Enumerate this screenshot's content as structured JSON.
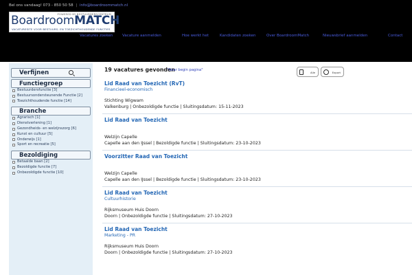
{
  "header": {
    "contact_phone": "Bel ons vandaag! 073 - 850 50 58",
    "separator": "|",
    "contact_email": "info@boardroommatch.nl",
    "logo_tagline": "POWERED BY BESTUURDERSCENTRUM",
    "logo_word_a": "Boardroom",
    "logo_word_b": "MATCH",
    "logo_subtitle": "VACATURESITE VOOR BESTUURS- EN TOEZICHTHOUDENDE FUNCTIES"
  },
  "nav": {
    "items": [
      "Vacatures zoeken",
      "Vacature aanmelden",
      "Hoe werkt het",
      "Kandidaten zoeken",
      "Over BoardroomMatch",
      "Nieuwsbrief aanmelden",
      "Contact"
    ]
  },
  "sidebar": {
    "refine_label": "Verfijnen",
    "groups": [
      {
        "title": "Functiegroep",
        "options": [
          "Bestuurdersfunctie [3]",
          "Bestuursondersteunende Functie [2]",
          "Toezichthoudende functie [14]"
        ]
      },
      {
        "title": "Branche",
        "options": [
          "Agrarisch [1]",
          "Dienstverlening [1]",
          "Gezondheids- en welzijnszorg [6]",
          "Kunst en cultuur [5]",
          "Onderwijs [1]",
          "Sport en recreatie [5]"
        ]
      },
      {
        "title": "Bezoldiging",
        "options": [
          "Betaalde baan [2]",
          "Bezoldigde functie [7]",
          "Onbezoldigde functie [10]"
        ]
      }
    ]
  },
  "results": {
    "count_text": "19 vacatures gevonden",
    "back_link": "\"Naar begin pagina\"",
    "tool_all": "Alle",
    "tool_export": "Export"
  },
  "vacancies": [
    {
      "title": "Lid Raad van Toezicht (RvT)",
      "category": "Financieel-economisch",
      "organisation": "Stichting Wigwam",
      "meta": "Valkenburg | Onbezoldigde functie | Sluitingsdatum: 15-11-2023"
    },
    {
      "title": "Lid Raad van Toezicht",
      "category": "",
      "organisation": "Welzijn Capelle",
      "meta": "Capelle aan den IJssel | Bezoldigde functie | Sluitingsdatum: 23-10-2023"
    },
    {
      "title": "Voorzitter Raad van Toezicht",
      "category": "",
      "organisation": "Welzijn Capelle",
      "meta": "Capelle aan den IJssel | Bezoldigde functie | Sluitingsdatum: 23-10-2023"
    },
    {
      "title": "Lid Raad van Toezicht",
      "category": "Cultuurhistorie",
      "organisation": "Rijksmuseum Huis Doorn",
      "meta": "Doorn | Onbezoldigde functie | Sluitingsdatum: 27-10-2023"
    },
    {
      "title": "Lid Raad van Toezicht",
      "category": "Marketing - PR",
      "organisation": "Rijksmuseum Huis Doorn",
      "meta": "Doorn | Onbezoldigde functie | Sluitingsdatum: 27-10-2023"
    }
  ]
}
